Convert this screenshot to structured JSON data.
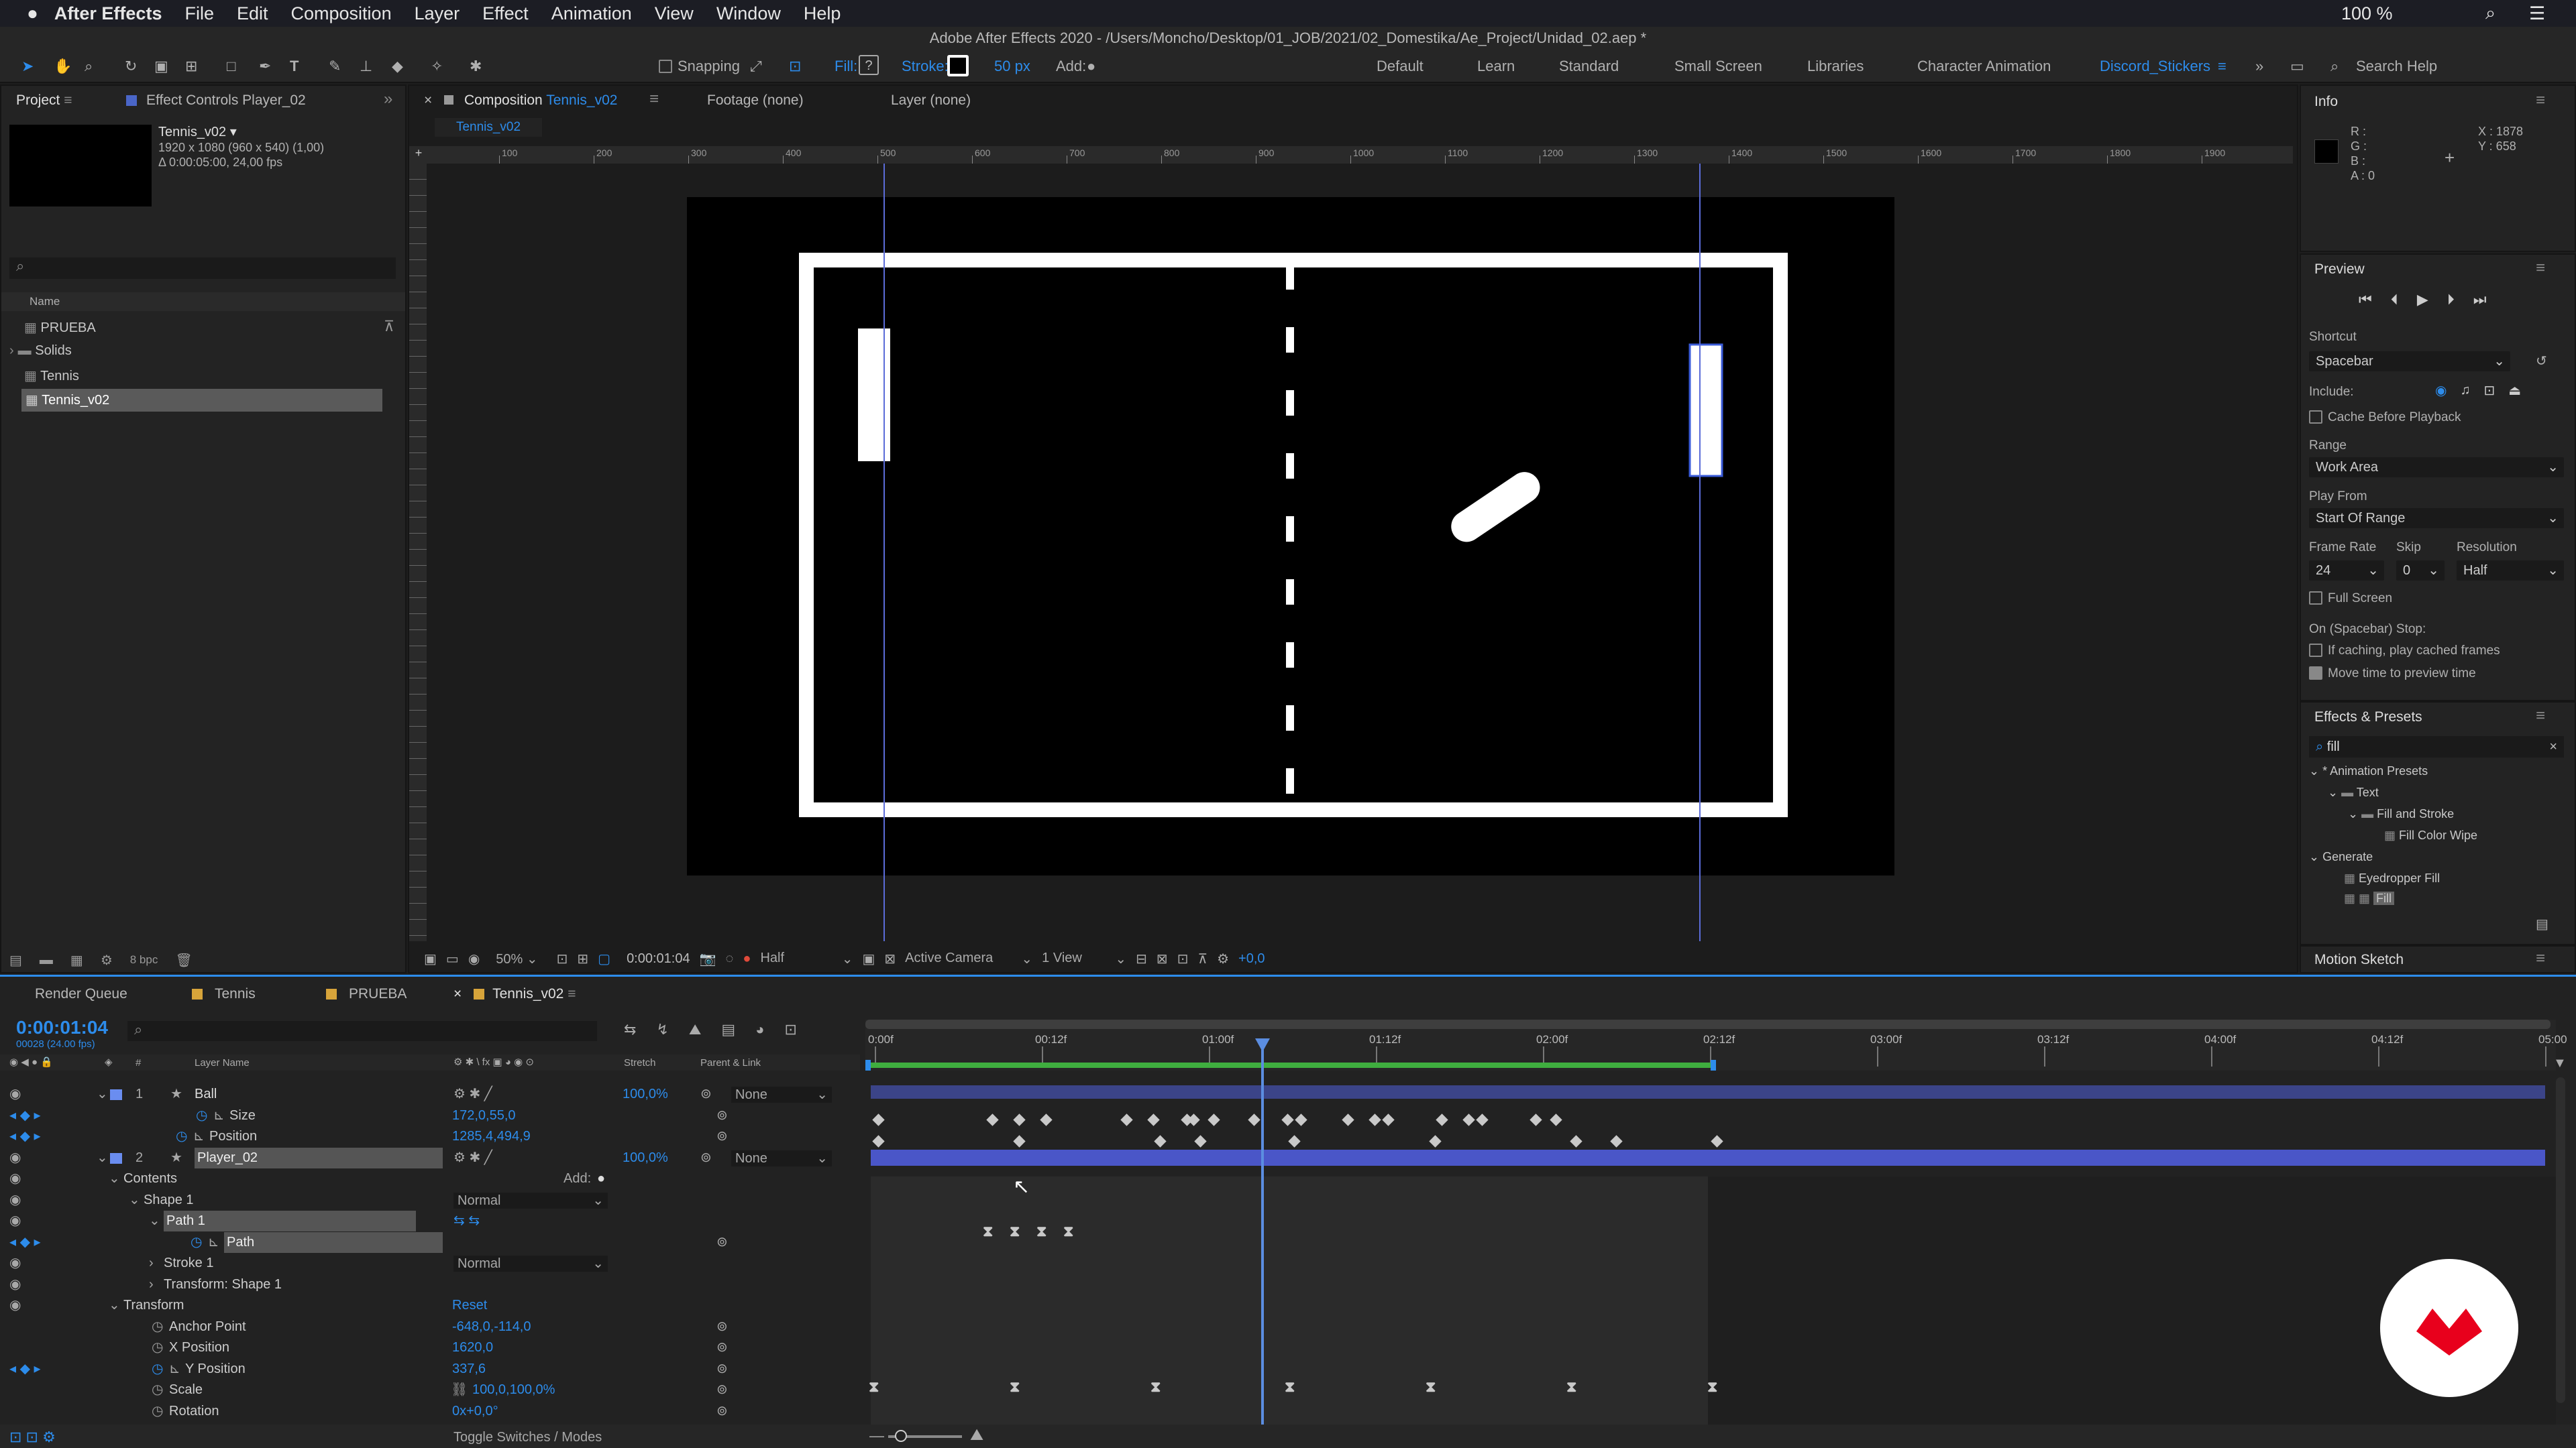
{
  "menubar": {
    "app": "After Effects",
    "items": [
      "File",
      "Edit",
      "Composition",
      "Layer",
      "Effect",
      "Animation",
      "View",
      "Window",
      "Help"
    ],
    "battery": "100 %"
  },
  "window_title": "Adobe After Effects 2020 - /Users/Moncho/Desktop/01_JOB/2021/02_Domestika/Ae_Project/Unidad_02.aep *",
  "toolbar": {
    "snapping": "Snapping",
    "fill": "Fill:",
    "stroke": "Stroke:",
    "stroke_width": "50 px",
    "add": "Add:",
    "workspaces": [
      "Default",
      "Learn",
      "Standard",
      "Small Screen",
      "Libraries",
      "Character Animation",
      "Discord_Stickers"
    ],
    "search": "Search Help"
  },
  "project": {
    "tab": "Project",
    "effect_tab": "Effect Controls Player_02",
    "comp_name": "Tennis_v02 ▾",
    "comp_info1": "1920 x 1080  (960 x 540) (1,00)",
    "comp_info2": "Δ 0:00:05:00, 24,00 fps",
    "col_name": "Name",
    "items": [
      "PRUEBA",
      "Solids",
      "Tennis",
      "Tennis_v02"
    ],
    "bpc": "8 bpc"
  },
  "viewer": {
    "tab_label": "Composition",
    "tab_comp": "Tennis_v02",
    "footage": "Footage (none)",
    "layer": "Layer (none)",
    "subtab": "Tennis_v02",
    "ruler": [
      "100",
      "200",
      "300",
      "400",
      "500",
      "600",
      "700",
      "800",
      "900",
      "1000",
      "1100",
      "1200",
      "1300",
      "1400",
      "1500",
      "1600",
      "1700",
      "1800",
      "1900"
    ],
    "zoom": "50%",
    "time": "0:00:01:04",
    "resolution": "Half",
    "camera": "Active Camera",
    "views": "1 View",
    "exposure": "+0,0"
  },
  "info": {
    "title": "Info",
    "r": "R :",
    "g": "G :",
    "b": "B :",
    "a": "A : 0",
    "x": "X : 1878",
    "y": "Y : 658"
  },
  "preview": {
    "title": "Preview",
    "shortcut_label": "Shortcut",
    "shortcut": "Spacebar",
    "include": "Include:",
    "cache": "Cache Before Playback",
    "range_label": "Range",
    "range": "Work Area",
    "playfrom_label": "Play From",
    "playfrom": "Start Of Range",
    "fr_label": "Frame Rate",
    "skip_label": "Skip",
    "res_label": "Resolution",
    "fr": "24",
    "skip": "0",
    "res": "Half",
    "fullscreen": "Full Screen",
    "stop_label": "On (Spacebar) Stop:",
    "if_caching": "If caching, play cached frames",
    "move_time": "Move time to preview time"
  },
  "effects": {
    "title": "Effects & Presets",
    "search": "fill",
    "tree": [
      "* Animation Presets",
      "Text",
      "Fill and Stroke",
      "Fill Color Wipe",
      "Generate",
      "Eyedropper Fill",
      "Fill"
    ]
  },
  "motion_sketch": "Motion Sketch",
  "timeline": {
    "tabs": [
      "Render Queue",
      "Tennis",
      "PRUEBA",
      "Tennis_v02"
    ],
    "timecode": "0:00:01:04",
    "fps": "00028 (24.00 fps)",
    "cols": {
      "num": "#",
      "name": "Layer Name",
      "stretch": "Stretch",
      "parent": "Parent & Link"
    },
    "ruler": [
      "0:00f",
      "00:12f",
      "01:00f",
      "01:12f",
      "02:00f",
      "02:12f",
      "03:00f",
      "03:12f",
      "04:00f",
      "04:12f",
      "05:00"
    ],
    "layers": [
      {
        "num": "1",
        "name": "Ball",
        "stretch": "100,0%",
        "parent": "None"
      },
      {
        "prop": "Size",
        "value": "172,0,55,0"
      },
      {
        "prop": "Position",
        "value": "1285,4,494,9"
      },
      {
        "num": "2",
        "name": "Player_02",
        "stretch": "100,0%",
        "parent": "None"
      },
      {
        "prop": "Contents",
        "add": "Add:"
      },
      {
        "prop": "Shape 1",
        "mode": "Normal"
      },
      {
        "prop": "Path 1"
      },
      {
        "prop": "Path"
      },
      {
        "prop": "Stroke 1",
        "mode": "Normal"
      },
      {
        "prop": "Transform: Shape 1"
      },
      {
        "prop": "Transform",
        "reset": "Reset"
      },
      {
        "prop": "Anchor Point",
        "value": "-648,0,-114,0"
      },
      {
        "prop": "X Position",
        "value": "1620,0"
      },
      {
        "prop": "Y Position",
        "value": "337,6"
      },
      {
        "prop": "Scale",
        "value": "100,0,100,0%"
      },
      {
        "prop": "Rotation",
        "value": "0x+0,0°"
      }
    ],
    "footer": "Toggle Switches / Modes"
  },
  "colors": {
    "accent": "#2d8ceb",
    "playhead": "#5b8de0",
    "layer_bar": "#4a56c8",
    "workarea": "#3fae3f",
    "logo": "#e8001c"
  }
}
